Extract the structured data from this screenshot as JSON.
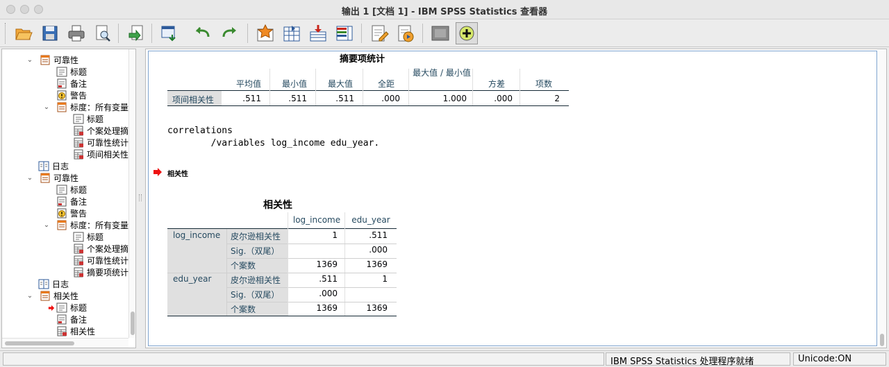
{
  "window": {
    "title": "输出 1 [文档 1] - IBM SPSS Statistics 查看器"
  },
  "toolbar": {
    "buttons": [
      {
        "name": "open-icon"
      },
      {
        "name": "save-icon"
      },
      {
        "name": "print-icon"
      },
      {
        "name": "print-preview-icon"
      },
      {
        "name": "export-icon"
      },
      {
        "name": "recall-dialog-icon"
      },
      {
        "name": "undo-icon"
      },
      {
        "name": "redo-icon"
      },
      {
        "name": "goto-case-icon"
      },
      {
        "name": "goto-variable-icon"
      },
      {
        "name": "insert-cases-icon"
      },
      {
        "name": "variables-icon"
      },
      {
        "name": "edit-icon"
      },
      {
        "name": "designate-window-icon"
      },
      {
        "name": "hide-icon"
      },
      {
        "name": "show-icon"
      }
    ]
  },
  "nav": {
    "items": [
      {
        "label": "可靠性",
        "icon": "procedure-icon",
        "level": 1,
        "chevron": "⌄"
      },
      {
        "label": "标题",
        "icon": "title-icon",
        "level": 2
      },
      {
        "label": "备注",
        "icon": "notes-icon",
        "level": 2
      },
      {
        "label": "警告",
        "icon": "warning-icon",
        "level": 2
      },
      {
        "label": "标度：所有变量",
        "icon": "procedure-icon",
        "level": 2,
        "chevron": "⌄"
      },
      {
        "label": "标题",
        "icon": "title-icon",
        "level": 3
      },
      {
        "label": "个案处理摘",
        "icon": "table-icon",
        "level": 3
      },
      {
        "label": "可靠性统计",
        "icon": "table-icon",
        "level": 3
      },
      {
        "label": "项间相关性",
        "icon": "table-icon",
        "level": 3
      },
      {
        "label": "日志",
        "icon": "log-icon",
        "level": 0
      },
      {
        "label": "可靠性",
        "icon": "procedure-icon",
        "level": 1,
        "chevron": "⌄"
      },
      {
        "label": "标题",
        "icon": "title-icon",
        "level": 2
      },
      {
        "label": "备注",
        "icon": "notes-icon",
        "level": 2
      },
      {
        "label": "警告",
        "icon": "warning-icon",
        "level": 2
      },
      {
        "label": "标度：所有变量",
        "icon": "procedure-icon",
        "level": 2,
        "chevron": "⌄"
      },
      {
        "label": "标题",
        "icon": "title-icon",
        "level": 3
      },
      {
        "label": "个案处理摘",
        "icon": "table-icon",
        "level": 3
      },
      {
        "label": "可靠性统计",
        "icon": "table-icon",
        "level": 3
      },
      {
        "label": "摘要项统计",
        "icon": "table-icon",
        "level": 3
      },
      {
        "label": "日志",
        "icon": "log-icon",
        "level": 0
      },
      {
        "label": "相关性",
        "icon": "procedure-icon",
        "level": 1,
        "chevron": "⌄"
      },
      {
        "label": "标题",
        "icon": "title-icon",
        "level": 2,
        "current": true
      },
      {
        "label": "备注",
        "icon": "notes-icon",
        "level": 2
      },
      {
        "label": "相关性",
        "icon": "table-icon",
        "level": 2
      }
    ]
  },
  "summary_table": {
    "title": "摘要项统计",
    "headers": [
      "平均值",
      "最小值",
      "最大值",
      "全距",
      "最大值 / 最小值",
      "方差",
      "项数"
    ],
    "row_label": "项间相关性",
    "values": [
      ".511",
      ".511",
      ".511",
      ".000",
      "1.000",
      ".000",
      "2"
    ]
  },
  "syntax": {
    "line1": "correlations",
    "line2": "        /variables log_income edu_year."
  },
  "section_heading": "相关性",
  "corr_table": {
    "title": "相关性",
    "col_headers": [
      "log_income",
      "edu_year"
    ],
    "rows": [
      {
        "var": "log_income",
        "stat": "皮尔逊相关性",
        "v1": "1",
        "v2": ".511"
      },
      {
        "var": "",
        "stat": "Sig.（双尾）",
        "v1": "",
        "v2": ".000"
      },
      {
        "var": "",
        "stat": "个案数",
        "v1": "1369",
        "v2": "1369"
      },
      {
        "var": "edu_year",
        "stat": "皮尔逊相关性",
        "v1": ".511",
        "v2": "1"
      },
      {
        "var": "",
        "stat": "Sig.（双尾）",
        "v1": ".000",
        "v2": ""
      },
      {
        "var": "",
        "stat": "个案数",
        "v1": "1369",
        "v2": "1369"
      }
    ]
  },
  "statusbar": {
    "status": "IBM SPSS Statistics 处理程序就绪",
    "unicode": "Unicode:ON"
  }
}
